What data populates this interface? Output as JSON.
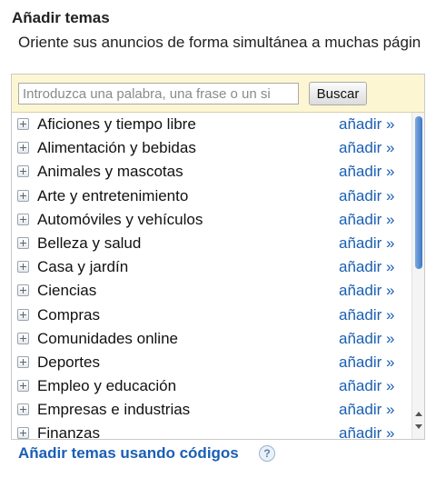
{
  "header": {
    "title": "Añadir temas",
    "subtitle": "Oriente sus anuncios de forma simultánea a muchas págin"
  },
  "search": {
    "placeholder": "Introduzca una palabra, una frase o un si",
    "button_label": "Buscar"
  },
  "topics": {
    "items": [
      {
        "label": "Aficiones y tiempo libre",
        "action": "añadir »"
      },
      {
        "label": "Alimentación y bebidas",
        "action": "añadir »"
      },
      {
        "label": "Animales y mascotas",
        "action": "añadir »"
      },
      {
        "label": "Arte y entretenimiento",
        "action": "añadir »"
      },
      {
        "label": "Automóviles y vehículos",
        "action": "añadir »"
      },
      {
        "label": "Belleza y salud",
        "action": "añadir »"
      },
      {
        "label": "Casa y jardín",
        "action": "añadir »"
      },
      {
        "label": "Ciencias",
        "action": "añadir »"
      },
      {
        "label": "Compras",
        "action": "añadir »"
      },
      {
        "label": "Comunidades online",
        "action": "añadir »"
      },
      {
        "label": "Deportes",
        "action": "añadir »"
      },
      {
        "label": "Empleo y educación",
        "action": "añadir »"
      },
      {
        "label": "Empresas e industrias",
        "action": "añadir »"
      },
      {
        "label": "Finanzas",
        "action": "añadir »"
      }
    ]
  },
  "footer": {
    "link_label": "Añadir temas usando códigos",
    "help_glyph": "?"
  },
  "colors": {
    "link": "#1a5fb4",
    "search_bar_bg": "#fdf6d3",
    "scroll_thumb": "#3d78c8"
  }
}
